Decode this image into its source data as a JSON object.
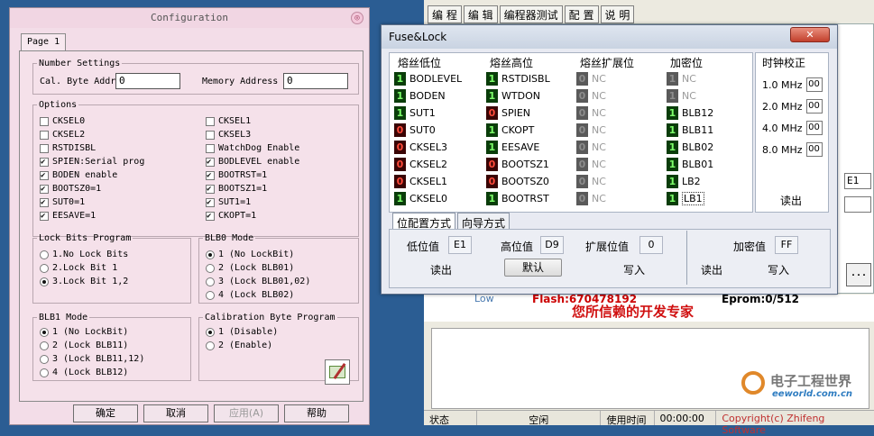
{
  "config": {
    "title": "Configuration",
    "tab": "Page 1",
    "number_settings": {
      "legend": "Number Settings",
      "cal_label": "Cal. Byte Addr",
      "cal_value": "0",
      "mem_label": "Memory Address",
      "mem_value": "0"
    },
    "options": {
      "legend": "Options",
      "items": [
        {
          "label": "CKSEL0",
          "checked": false
        },
        {
          "label": "CKSEL1",
          "checked": false
        },
        {
          "label": "CKSEL2",
          "checked": false
        },
        {
          "label": "CKSEL3",
          "checked": false
        },
        {
          "label": "RSTDISBL",
          "checked": false
        },
        {
          "label": "WatchDog Enable",
          "checked": false
        },
        {
          "label": "SPIEN:Serial prog",
          "checked": true
        },
        {
          "label": "BODLEVEL enable",
          "checked": true
        },
        {
          "label": "BODEN enable",
          "checked": true
        },
        {
          "label": "BOOTRST=1",
          "checked": true
        },
        {
          "label": "BOOTSZ0=1",
          "checked": true
        },
        {
          "label": "BOOTSZ1=1",
          "checked": true
        },
        {
          "label": "SUT0=1",
          "checked": true
        },
        {
          "label": "SUT1=1",
          "checked": true
        },
        {
          "label": "EESAVE=1",
          "checked": true
        },
        {
          "label": "CKOPT=1",
          "checked": true
        }
      ]
    },
    "lock_bits": {
      "legend": "Lock Bits Program",
      "items": [
        {
          "label": "1.No Lock Bits",
          "checked": false
        },
        {
          "label": "2.Lock Bit 1",
          "checked": false
        },
        {
          "label": "3.Lock Bit 1,2",
          "checked": true
        }
      ]
    },
    "blb0": {
      "legend": "BLB0 Mode",
      "items": [
        {
          "label": "1 (No LockBit)",
          "checked": true
        },
        {
          "label": "2 (Lock BLB01)",
          "checked": false
        },
        {
          "label": "3 (Lock BLB01,02)",
          "checked": false
        },
        {
          "label": "4 (Lock BLB02)",
          "checked": false
        }
      ]
    },
    "blb1": {
      "legend": "BLB1 Mode",
      "items": [
        {
          "label": "1 (No LockBit)",
          "checked": true
        },
        {
          "label": "2 (Lock BLB11)",
          "checked": false
        },
        {
          "label": "3 (Lock BLB11,12)",
          "checked": false
        },
        {
          "label": "4 (Lock BLB12)",
          "checked": false
        }
      ]
    },
    "calib": {
      "legend": "Calibration Byte Program",
      "items": [
        {
          "label": "1 (Disable)",
          "checked": true
        },
        {
          "label": "2 (Enable)",
          "checked": false
        }
      ]
    },
    "buttons": {
      "ok": "确定",
      "cancel": "取消",
      "apply": "应用(A)",
      "help": "帮助"
    }
  },
  "fuse": {
    "title": "Fuse&Lock",
    "close": "✕",
    "headers": {
      "low": "熔丝低位",
      "high": "熔丝高位",
      "ext": "熔丝扩展位",
      "lock": "加密位",
      "clock": "时钟校正"
    },
    "low": [
      {
        "v": "1",
        "c": "g",
        "label": "BODLEVEL"
      },
      {
        "v": "1",
        "c": "g",
        "label": "BODEN"
      },
      {
        "v": "1",
        "c": "g",
        "label": "SUT1"
      },
      {
        "v": "0",
        "c": "r",
        "label": "SUT0"
      },
      {
        "v": "0",
        "c": "r",
        "label": "CKSEL3"
      },
      {
        "v": "0",
        "c": "r",
        "label": "CKSEL2"
      },
      {
        "v": "0",
        "c": "r",
        "label": "CKSEL1"
      },
      {
        "v": "1",
        "c": "g",
        "label": "CKSEL0"
      }
    ],
    "high": [
      {
        "v": "1",
        "c": "g",
        "label": "RSTDISBL"
      },
      {
        "v": "1",
        "c": "g",
        "label": "WTDON"
      },
      {
        "v": "0",
        "c": "r",
        "label": "SPIEN"
      },
      {
        "v": "1",
        "c": "g",
        "label": "CKOPT"
      },
      {
        "v": "1",
        "c": "g",
        "label": "EESAVE"
      },
      {
        "v": "0",
        "c": "r",
        "label": "BOOTSZ1"
      },
      {
        "v": "0",
        "c": "r",
        "label": "BOOTSZ0"
      },
      {
        "v": "1",
        "c": "g",
        "label": "BOOTRST"
      }
    ],
    "ext": [
      {
        "v": "0",
        "c": "d",
        "label": "NC"
      },
      {
        "v": "0",
        "c": "d",
        "label": "NC"
      },
      {
        "v": "0",
        "c": "d",
        "label": "NC"
      },
      {
        "v": "0",
        "c": "d",
        "label": "NC"
      },
      {
        "v": "0",
        "c": "d",
        "label": "NC"
      },
      {
        "v": "0",
        "c": "d",
        "label": "NC"
      },
      {
        "v": "0",
        "c": "d",
        "label": "NC"
      },
      {
        "v": "0",
        "c": "d",
        "label": "NC"
      }
    ],
    "lock": [
      {
        "v": "1",
        "c": "d",
        "label": "NC"
      },
      {
        "v": "1",
        "c": "d",
        "label": "NC"
      },
      {
        "v": "1",
        "c": "g",
        "label": "BLB12"
      },
      {
        "v": "1",
        "c": "g",
        "label": "BLB11"
      },
      {
        "v": "1",
        "c": "g",
        "label": "BLB02"
      },
      {
        "v": "1",
        "c": "g",
        "label": "BLB01"
      },
      {
        "v": "1",
        "c": "g",
        "label": "LB2"
      },
      {
        "v": "1",
        "c": "g",
        "label": "LB1"
      }
    ],
    "clock": [
      {
        "label": "1.0 MHz",
        "value": "00"
      },
      {
        "label": "2.0 MHz",
        "value": "00"
      },
      {
        "label": "4.0 MHz",
        "value": "00"
      },
      {
        "label": "8.0 MHz",
        "value": "00"
      }
    ],
    "clock_read": "读出",
    "tabs": {
      "bit": "位配置方式",
      "wizard": "向导方式"
    },
    "low_label": "低位值",
    "low_value": "E1",
    "high_label": "高位值",
    "high_value": "D9",
    "ext_label": "扩展位值",
    "ext_value": "0",
    "lock_label": "加密值",
    "lock_value": "FF",
    "read": "读出",
    "default": "默认",
    "write": "写入",
    "read2": "读出",
    "write2": "写入"
  },
  "background": {
    "menu": [
      "编 程",
      "编 辑",
      "编程器测试",
      "配 置",
      "说 明"
    ],
    "low_text": "Low",
    "flash": "Flash:670478192",
    "eprom": "Eprom:0/512",
    "slogan": "您所信赖的开发专家",
    "side_value": "E1",
    "dots": "...",
    "status": [
      "状态",
      "空闲",
      "使用时间",
      "00:00:00"
    ],
    "copyright": "Copyright(c) Zhifeng Software"
  },
  "watermark": {
    "brand": "电子工程世界",
    "url": "eeworld.com.cn"
  }
}
